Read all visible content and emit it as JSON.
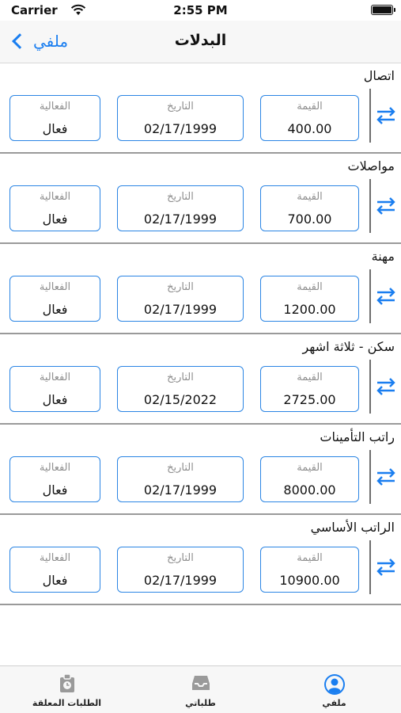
{
  "status_bar": {
    "carrier": "Carrier",
    "time": "2:55 PM"
  },
  "nav": {
    "back_label": "ملفي",
    "title": "البدلات"
  },
  "accent_color": "#1a7ef0",
  "field_labels": {
    "value": "القيمة",
    "date": "التاريخ",
    "status": "الفعالية"
  },
  "allowances": [
    {
      "name": "اتصال",
      "value": "400.00",
      "date": "02/17/1999",
      "status": "فعال"
    },
    {
      "name": "مواصلات",
      "value": "700.00",
      "date": "02/17/1999",
      "status": "فعال"
    },
    {
      "name": "مهنة",
      "value": "1200.00",
      "date": "02/17/1999",
      "status": "فعال"
    },
    {
      "name": "سكن - ثلاثة اشهر",
      "value": "2725.00",
      "date": "02/15/2022",
      "status": "فعال"
    },
    {
      "name": "راتب التأمينات",
      "value": "8000.00",
      "date": "02/17/1999",
      "status": "فعال"
    },
    {
      "name": "الراتب الأساسي",
      "value": "10900.00",
      "date": "02/17/1999",
      "status": "فعال"
    }
  ],
  "tabs": [
    {
      "label": "الطلبات المعلقة",
      "icon": "pending-requests-icon"
    },
    {
      "label": "طلباتي",
      "icon": "inbox-icon"
    },
    {
      "label": "ملفي",
      "icon": "profile-icon",
      "active": true
    }
  ]
}
